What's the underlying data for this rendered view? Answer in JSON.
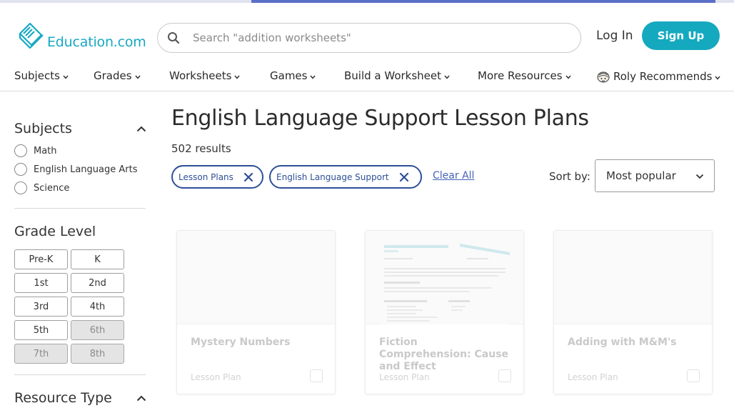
{
  "header": {
    "logo_text": "Education.com",
    "search_placeholder": "Search \"addition worksheets\"",
    "login_label": "Log In",
    "signup_label": "Sign Up"
  },
  "nav": {
    "items": [
      "Subjects",
      "Grades",
      "Worksheets",
      "Games",
      "Build a Worksheet",
      "More Resources",
      "Roly Recommends"
    ]
  },
  "sidebar": {
    "subjects_heading": "Subjects",
    "subjects": [
      "Math",
      "English Language Arts",
      "Science"
    ],
    "grade_heading": "Grade Level",
    "grades": [
      {
        "label": "Pre-K",
        "muted": false
      },
      {
        "label": "K",
        "muted": false
      },
      {
        "label": "1st",
        "muted": false
      },
      {
        "label": "2nd",
        "muted": false
      },
      {
        "label": "3rd",
        "muted": false
      },
      {
        "label": "4th",
        "muted": false
      },
      {
        "label": "5th",
        "muted": false
      },
      {
        "label": "6th",
        "muted": true
      },
      {
        "label": "7th",
        "muted": true
      },
      {
        "label": "8th",
        "muted": true
      }
    ],
    "resource_heading": "Resource Type"
  },
  "main": {
    "title": "English Language Support Lesson Plans",
    "results": "502 results",
    "filters": [
      "Lesson Plans",
      "English Language Support"
    ],
    "clear_all": "Clear All",
    "sort_label": "Sort by:",
    "sort_value": "Most popular"
  },
  "cards": [
    {
      "title": "Mystery Numbers",
      "type": "Lesson Plan"
    },
    {
      "title": "Fiction Comprehension: Cause and Effect",
      "type": "Lesson Plan"
    },
    {
      "title": "Adding with M&M's",
      "type": "Lesson Plan"
    }
  ],
  "colors": {
    "brand": "#17a8c3",
    "signup": "#14a9bf",
    "chip": "#2e4f98",
    "link": "#4563b8"
  },
  "icons": {
    "search": "search-icon",
    "chevron": "chevron-down-icon",
    "close": "close-icon",
    "roly": "roly-icon"
  }
}
